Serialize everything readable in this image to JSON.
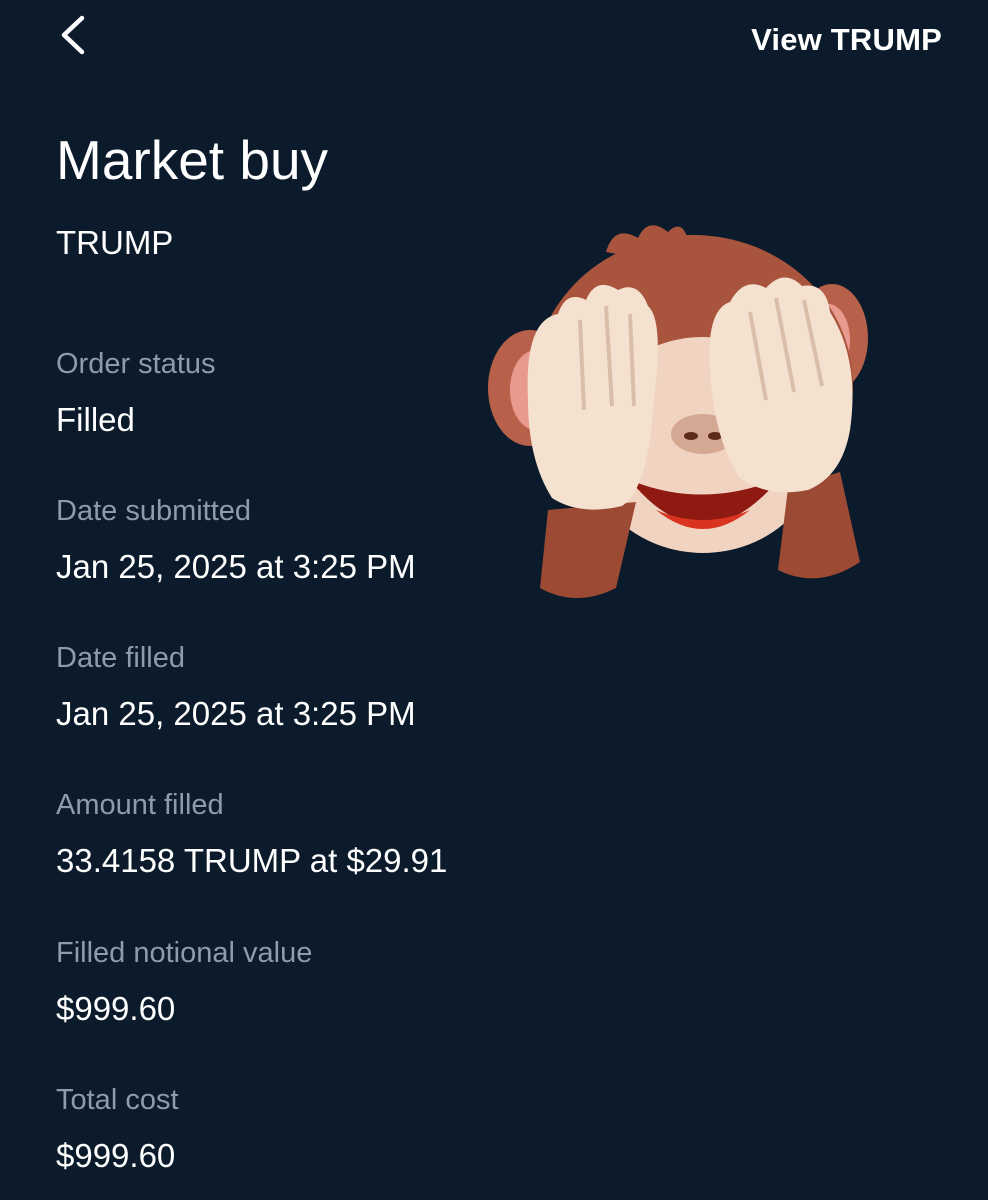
{
  "header": {
    "back_icon": "chevron-left-icon",
    "view_link": "View TRUMP"
  },
  "title": "Market buy",
  "subtitle": "TRUMP",
  "fields": {
    "order_status": {
      "label": "Order status",
      "value": "Filled"
    },
    "date_submitted": {
      "label": "Date submitted",
      "value": "Jan 25, 2025 at 3:25 PM"
    },
    "date_filled": {
      "label": "Date filled",
      "value": "Jan 25, 2025 at 3:25 PM"
    },
    "amount_filled": {
      "label": "Amount filled",
      "value": "33.4158 TRUMP at $29.91"
    },
    "filled_notional_value": {
      "label": "Filled notional value",
      "value": "$999.60"
    },
    "total_cost": {
      "label": "Total cost",
      "value": "$999.60"
    }
  },
  "sticker": {
    "icon": "see-no-evil-monkey-icon"
  },
  "colors": {
    "background": "#0b1b2b",
    "label": "#8d9bab",
    "text": "#ffffff"
  }
}
